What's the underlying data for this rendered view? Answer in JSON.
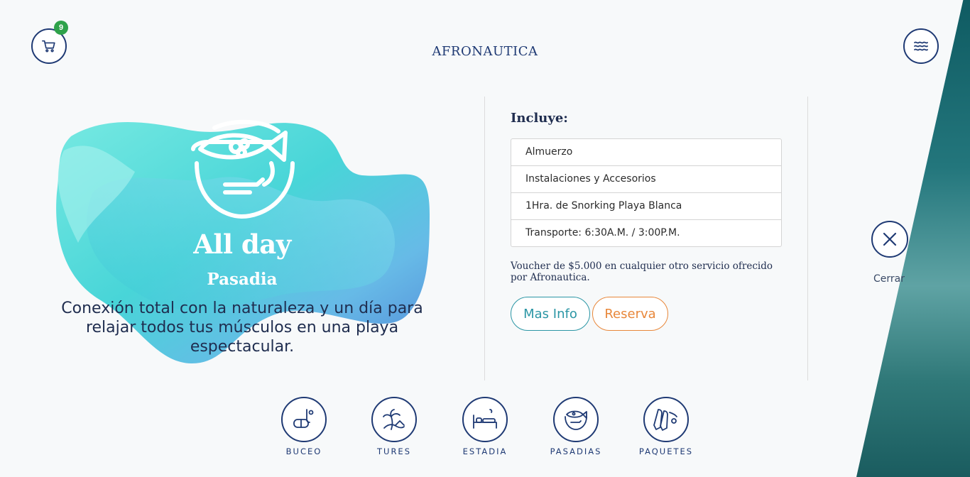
{
  "header": {
    "cart_count": "9",
    "logo_text": "AFRONAUTICA"
  },
  "hero": {
    "title": "All day",
    "subtitle": "Pasadia",
    "description": "Conexión total con la naturaleza y un día para relajar todos tus músculos en una playa espectacular."
  },
  "includes": {
    "title": "Incluye:",
    "items": [
      "Almuerzo",
      "Instalaciones y Accesorios",
      "1Hra. de Snorking Playa Blanca",
      "Transporte: 6:30A.M. / 3:00P.M."
    ],
    "voucher": "Voucher de $5.000 en cualquier otro servicio ofrecido por Afronautica.",
    "more_info_label": "Mas Info",
    "reserve_label": "Reserva"
  },
  "close": {
    "label": "Cerrar"
  },
  "bottom_nav": [
    {
      "label": "BUCEO",
      "icon": "snorkel-mask-icon"
    },
    {
      "label": "TURES",
      "icon": "palm-beach-icon"
    },
    {
      "label": "ESTADIA",
      "icon": "bed-icon"
    },
    {
      "label": "PASADIAS",
      "icon": "fish-bowl-icon"
    },
    {
      "label": "PAQUETES",
      "icon": "flippers-icon"
    }
  ],
  "colors": {
    "navy": "#1f3a74",
    "teal_accent": "#2b96a5",
    "orange_accent": "#e8873a",
    "badge_green": "#2ea24a"
  }
}
